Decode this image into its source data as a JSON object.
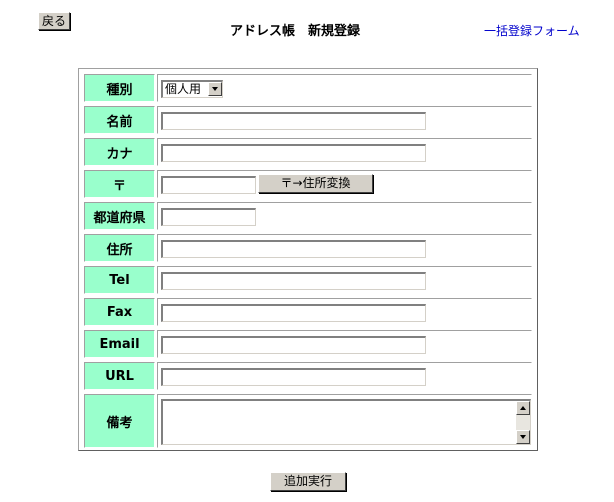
{
  "header": {
    "back_label": "戻る",
    "title": "アドレス帳　新規登録",
    "bulk_link": "一括登録フォーム"
  },
  "form": {
    "rows": [
      {
        "label": "種別",
        "type": "select",
        "value": "個人用"
      },
      {
        "label": "名前",
        "type": "text",
        "value": ""
      },
      {
        "label": "カナ",
        "type": "text",
        "value": ""
      },
      {
        "label": "〒",
        "type": "zip",
        "value": "",
        "button": "〒→住所変換"
      },
      {
        "label": "都道府県",
        "type": "short",
        "value": ""
      },
      {
        "label": "住所",
        "type": "text",
        "value": ""
      },
      {
        "label": "Tel",
        "type": "text",
        "value": ""
      },
      {
        "label": "Fax",
        "type": "text",
        "value": ""
      },
      {
        "label": "Email",
        "type": "text",
        "value": ""
      },
      {
        "label": "URL",
        "type": "text",
        "value": ""
      },
      {
        "label": "備考",
        "type": "textarea",
        "value": ""
      }
    ],
    "submit_label": "追加実行"
  },
  "colors": {
    "label_bg": "#99ffcc",
    "link": "#0000cc",
    "button_face": "#d4d0c8"
  }
}
